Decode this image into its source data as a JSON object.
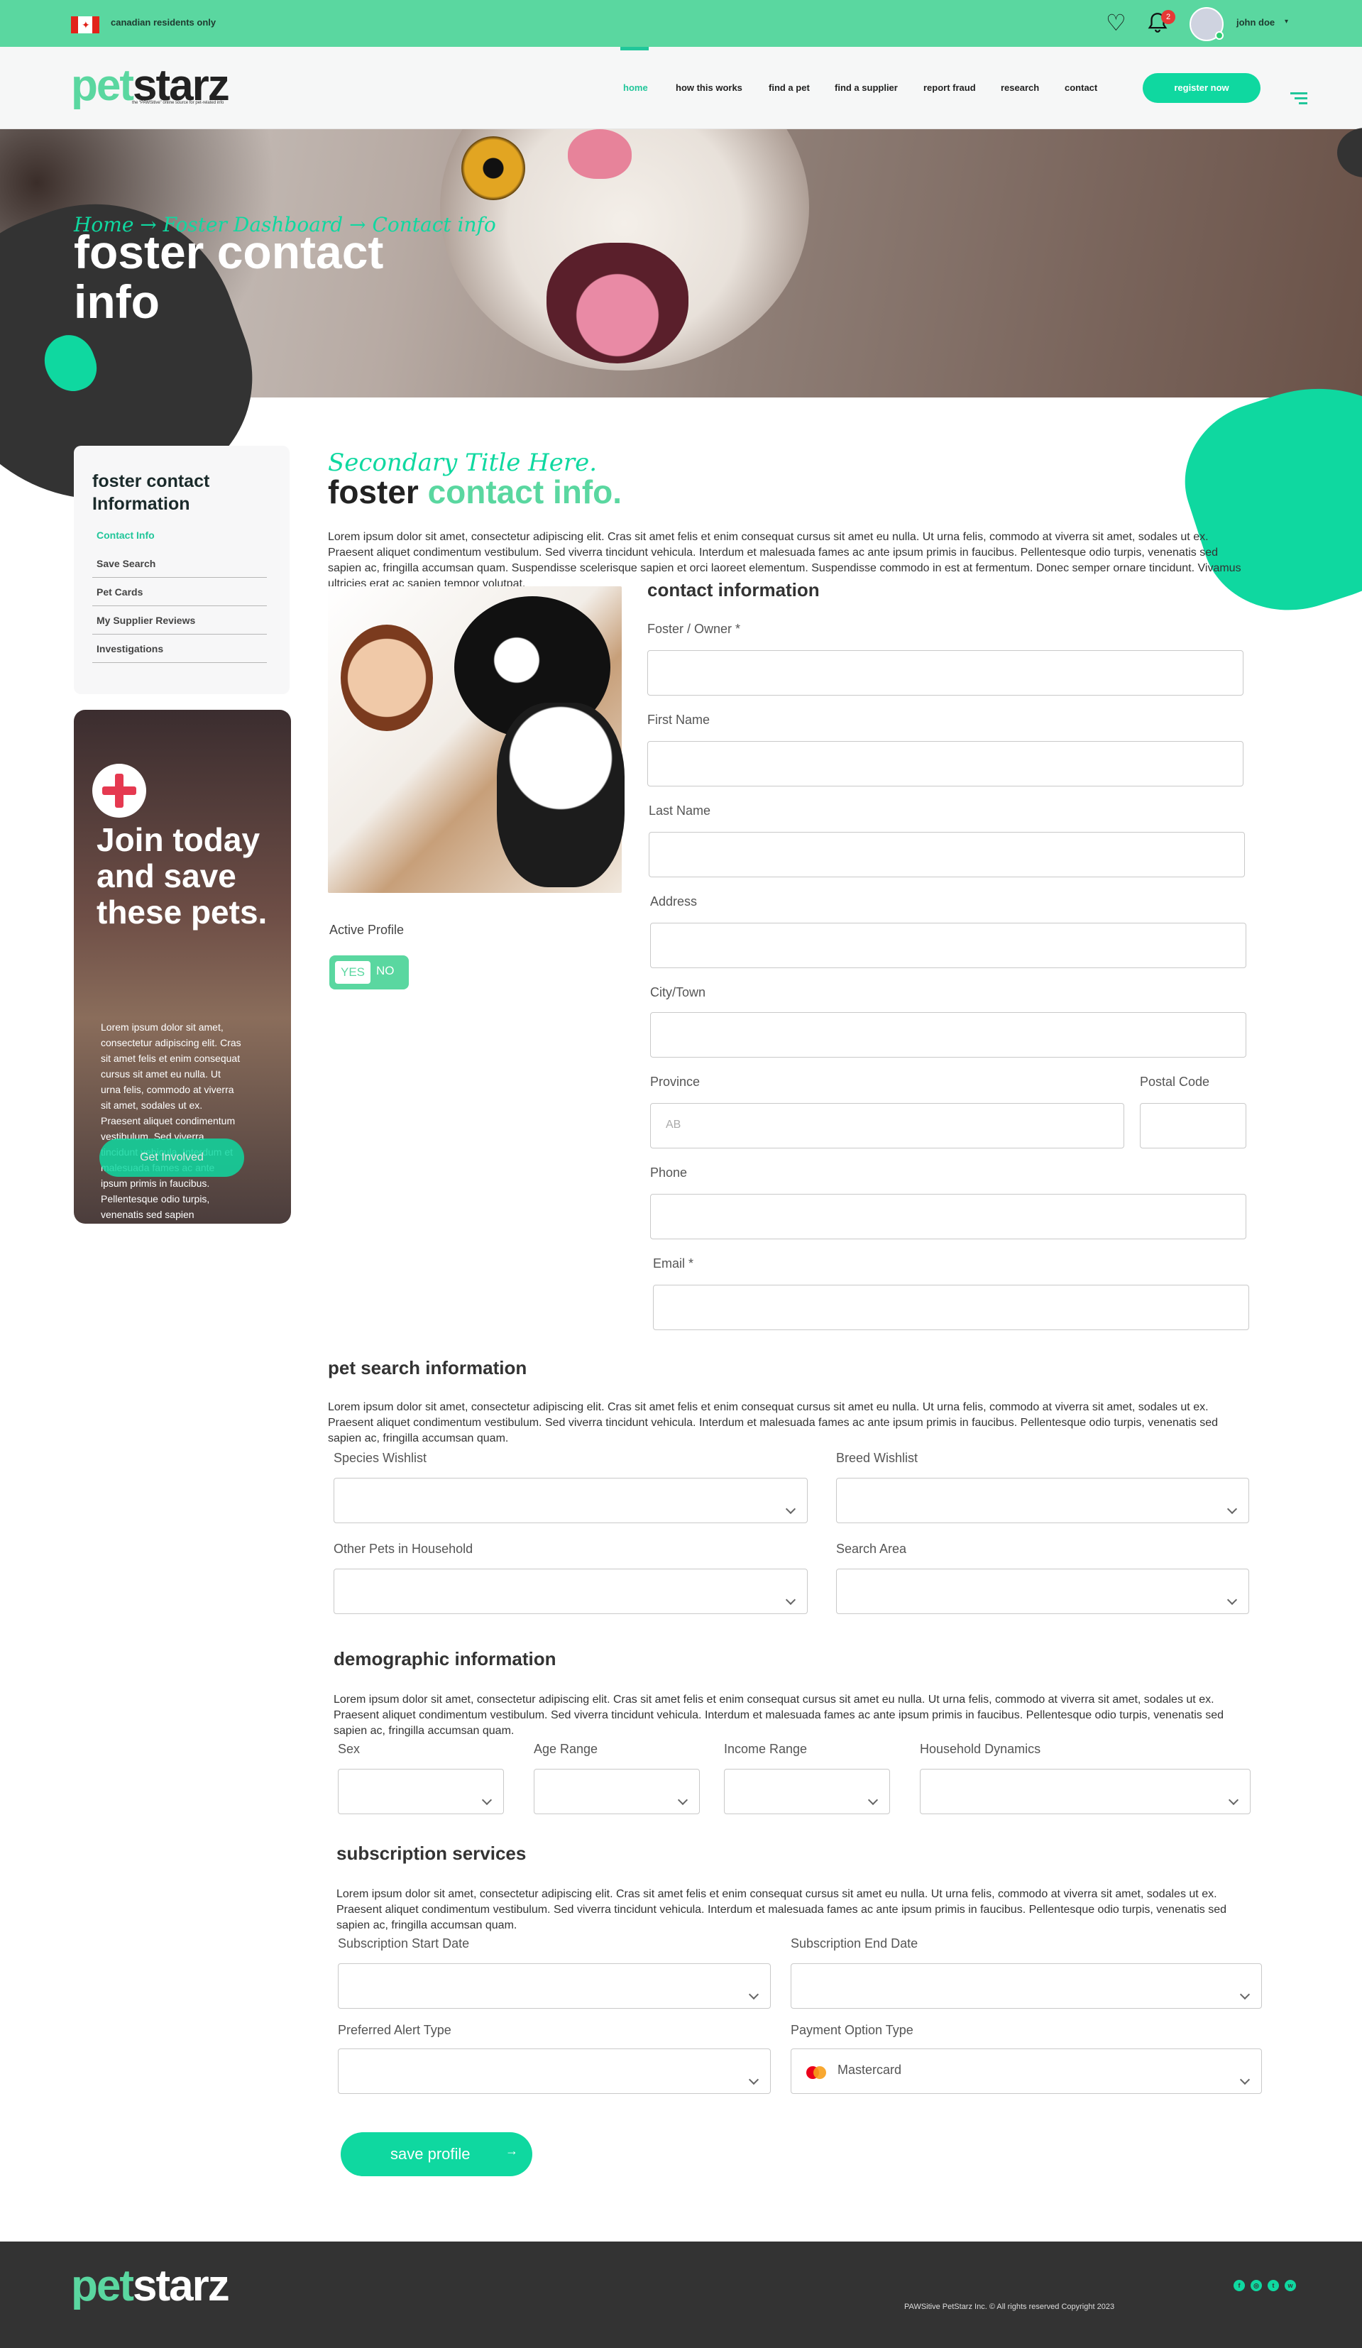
{
  "topbar": {
    "residents": "canadian residents only",
    "flag_glyph": "✦",
    "notification_count": "2",
    "username": "john doe",
    "caret": "▾",
    "heart_glyph": "♡"
  },
  "header": {
    "logo_pet": "pet",
    "logo_starz": "starz",
    "tagline": "the “PAWSitive” online source for pet-related info",
    "nav": [
      "home",
      "how this works",
      "find a pet",
      "find a supplier",
      "report fraud",
      "research",
      "contact"
    ],
    "register": "register now"
  },
  "hero": {
    "breadcrumb": "Home → Foster Dashboard → Contact info",
    "title": "foster contact info"
  },
  "sidebar": {
    "title": "foster contact Information",
    "items": [
      "Contact Info",
      "Save Search",
      "Pet Cards",
      "My Supplier Reviews",
      "Investigations"
    ]
  },
  "promo": {
    "title": "Join today and save these pets.",
    "text": "Lorem ipsum dolor sit amet, consectetur adipiscing elit. Cras sit amet felis et enim consequat cursus sit amet eu nulla. Ut urna felis, commodo at viverra sit amet, sodales ut ex. Praesent aliquet condimentum vestibulum. Sed viverra tincidunt vehicula. Interdum et malesuada fames ac ante ipsum primis in faucibus. Pellentesque odio turpis, venenatis sed sapien",
    "button": "Get Involved"
  },
  "main": {
    "script_title": "Secondary Title Here.",
    "title_dark": "foster ",
    "title_accent": "contact info.",
    "intro": "Lorem ipsum dolor sit amet, consectetur adipiscing elit. Cras sit amet felis et enim consequat cursus sit amet eu nulla. Ut urna felis, commodo at viverra sit amet, sodales ut ex. Praesent aliquet condimentum vestibulum. Sed viverra tincidunt vehicula. Interdum et malesuada fames ac ante ipsum primis in faucibus. Pellentesque odio turpis, venenatis sed sapien ac, fringilla accumsan quam. Suspendisse scelerisque sapien et orci laoreet elementum. Suspendisse commodo in est at fermentum. Donec semper ornare tincidunt. Vivamus ultricies erat ac sapien tempor volutpat.",
    "active_profile": "Active Profile",
    "toggle_yes": "YES",
    "toggle_no": "NO"
  },
  "contact": {
    "heading": "contact information",
    "fields": {
      "owner": "Foster / Owner *",
      "first": "First Name",
      "last": "Last Name",
      "address": "Address",
      "city": "City/Town",
      "province": "Province",
      "postal": "Postal Code",
      "phone": "Phone",
      "email": "Email *"
    },
    "province_placeholder": "AB"
  },
  "pet_search": {
    "heading": "pet search information",
    "text": "Lorem ipsum dolor sit amet, consectetur adipiscing elit. Cras sit amet felis et enim consequat cursus sit amet eu nulla. Ut urna felis, commodo at viverra sit amet, sodales ut ex. Praesent aliquet condimentum vestibulum. Sed viverra tincidunt vehicula. Interdum et malesuada fames ac ante ipsum primis in faucibus. Pellentesque odio turpis, venenatis sed sapien ac, fringilla accumsan quam.",
    "labels": [
      "Species Wishlist",
      "Breed Wishlist",
      "Other Pets in Household",
      "Search Area"
    ]
  },
  "demographic": {
    "heading": "demographic information",
    "text": "Lorem ipsum dolor sit amet, consectetur adipiscing elit. Cras sit amet felis et enim consequat cursus sit amet eu nulla. Ut urna felis, commodo at viverra sit amet, sodales ut ex. Praesent aliquet condimentum vestibulum. Sed viverra tincidunt vehicula. Interdum et malesuada fames ac ante ipsum primis in faucibus. Pellentesque odio turpis, venenatis sed sapien ac, fringilla accumsan quam.",
    "labels": [
      "Sex",
      "Age Range",
      "Income Range",
      "Household Dynamics"
    ]
  },
  "subscription": {
    "heading": "subscription services",
    "text": "Lorem ipsum dolor sit amet, consectetur adipiscing elit. Cras sit amet felis et enim consequat cursus sit amet eu nulla. Ut urna felis, commodo at viverra sit amet, sodales ut ex. Praesent aliquet condimentum vestibulum. Sed viverra tincidunt vehicula. Interdum et malesuada fames ac ante ipsum primis in faucibus. Pellentesque odio turpis, venenatis sed sapien ac, fringilla accumsan quam.",
    "labels": [
      "Subscription Start Date",
      "Subscription End Date",
      "Preferred Alert Type",
      "Payment Option Type"
    ],
    "payment_value": "Mastercard",
    "save": "save profile",
    "save_arrow": "→"
  },
  "footer": {
    "logo_pet": "pet",
    "logo_starz": "starz",
    "copyright": "PAWSitive PetStarz Inc. ©  All rights reserved Copyright 2023",
    "social": [
      "f",
      "◎",
      "t",
      "w"
    ]
  },
  "colors": {
    "brand_green": "#5ad7a0",
    "accent": "#0fd8a0",
    "dark": "#333333",
    "alert": "#e53935"
  }
}
